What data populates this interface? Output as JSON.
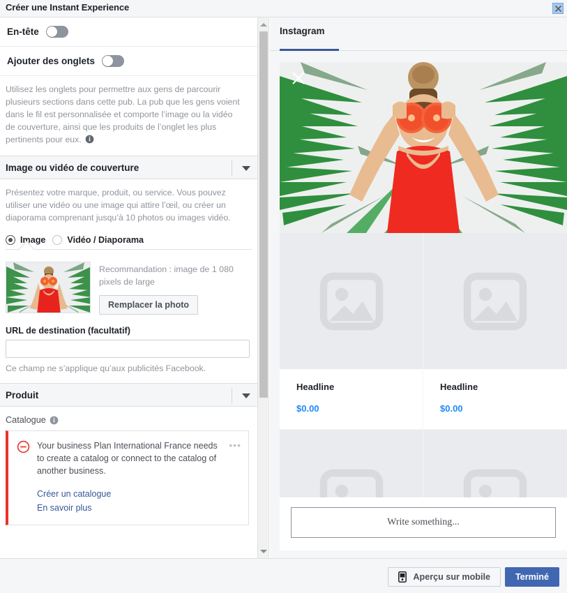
{
  "window": {
    "title": "Créer une Instant Experience",
    "close_icon": "close-icon"
  },
  "left_panel": {
    "header_row": {
      "label": "En-tête",
      "toggle_state": "off"
    },
    "tabs_row": {
      "label": "Ajouter des onglets",
      "toggle_state": "off"
    },
    "tabs_description": "Utilisez les onglets pour permettre aux gens de parcourir plusieurs sections dans cette pub. La pub que les gens voient dans le fil est personnalisée et comporte l’image ou la vidéo de couverture, ainsi que les produits de l’onglet les plus pertinents pour eux.",
    "cover_section": {
      "title": "Image ou vidéo de couverture",
      "description": "Présentez votre marque, produit, ou service. Vous pouvez utiliser une vidéo ou une image qui attire l’œil, ou créer un diaporama comprenant jusqu’à 10 photos ou images vidéo.",
      "radios": [
        {
          "label": "Image",
          "selected": true
        },
        {
          "label": "Vidéo / Diaporama",
          "selected": false
        }
      ],
      "recommendation": "Recommandation : image de 1 080 pixels de large",
      "replace_button": "Remplacer la photo",
      "url_label": "URL de destination (facultatif)",
      "url_value": "",
      "url_placeholder": "",
      "url_hint": "Ce champ ne s’applique qu’aux publicités Facebook."
    },
    "product_section": {
      "title": "Produit",
      "catalogue_label": "Catalogue",
      "alert": {
        "icon": "error-minus-circle-icon",
        "message": "Your business Plan International France needs to create a catalog or connect to the catalog of another business.",
        "links": [
          "Créer un catalogue",
          "En savoir plus"
        ],
        "menu_icon": "ellipsis-icon"
      }
    }
  },
  "right_panel": {
    "tabs": [
      {
        "label": "Instagram",
        "active": true
      }
    ],
    "hero": {
      "close_icon": "close-x-icon",
      "alt": "woman-with-grapefruit-photo"
    },
    "products": [
      {
        "headline": "Headline",
        "price": "$0.00",
        "image": "image-placeholder-icon"
      },
      {
        "headline": "Headline",
        "price": "$0.00",
        "image": "image-placeholder-icon"
      },
      {
        "headline": "",
        "price": "",
        "image": "image-placeholder-icon"
      },
      {
        "headline": "",
        "price": "",
        "image": "image-placeholder-icon"
      }
    ],
    "write_box_text": "Write something..."
  },
  "footer": {
    "mobile_preview_label": "Aperçu sur mobile",
    "mobile_preview_icon": "mobile-phone-icon",
    "done_label": "Terminé"
  },
  "colors": {
    "accent_blue": "#4267b2",
    "tab_underline": "#3b5998",
    "price_blue": "#1f8bf7",
    "link_blue": "#365899",
    "error_red": "#e9332c",
    "panel_bg": "#f5f6f7",
    "text_dark": "#1d2129",
    "text_muted": "#90949c"
  }
}
